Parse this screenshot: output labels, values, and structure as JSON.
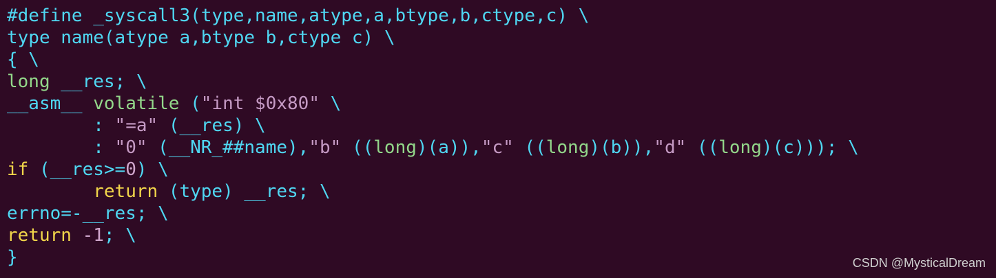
{
  "theme": {
    "background": "#2f0a24",
    "cyan": "#4fd7f2",
    "green": "#93d78a",
    "yellow": "#f1d54a",
    "string": "#c59ac4",
    "number": "#cfa6cc",
    "watermark": "#cfcfcf"
  },
  "lines": [
    {
      "tokens": [
        {
          "t": "#define _syscall3(type,name,atype,a,btype,b,ctype,c) \\",
          "c": "cyan"
        }
      ]
    },
    {
      "tokens": [
        {
          "t": "type name(atype a,btype b,ctype c) \\",
          "c": "cyan"
        }
      ]
    },
    {
      "tokens": [
        {
          "t": "{ \\",
          "c": "cyan"
        }
      ]
    },
    {
      "tokens": [
        {
          "t": "long",
          "c": "green"
        },
        {
          "t": " __res; \\",
          "c": "cyan"
        }
      ]
    },
    {
      "tokens": [
        {
          "t": "__asm__ ",
          "c": "cyan"
        },
        {
          "t": "volatile",
          "c": "green"
        },
        {
          "t": " (",
          "c": "cyan"
        },
        {
          "t": "\"int $0x80\"",
          "c": "string"
        },
        {
          "t": " \\",
          "c": "cyan"
        }
      ]
    },
    {
      "tokens": [
        {
          "t": "        : ",
          "c": "cyan"
        },
        {
          "t": "\"=a\"",
          "c": "string"
        },
        {
          "t": " (__res) \\",
          "c": "cyan"
        }
      ]
    },
    {
      "tokens": [
        {
          "t": "        : ",
          "c": "cyan"
        },
        {
          "t": "\"0\"",
          "c": "string"
        },
        {
          "t": " (__NR_##name),",
          "c": "cyan"
        },
        {
          "t": "\"b\"",
          "c": "string"
        },
        {
          "t": " ((",
          "c": "cyan"
        },
        {
          "t": "long",
          "c": "green"
        },
        {
          "t": ")(a)),",
          "c": "cyan"
        },
        {
          "t": "\"c\"",
          "c": "string"
        },
        {
          "t": " ((",
          "c": "cyan"
        },
        {
          "t": "long",
          "c": "green"
        },
        {
          "t": ")(b)),",
          "c": "cyan"
        },
        {
          "t": "\"d\"",
          "c": "string"
        },
        {
          "t": " ((",
          "c": "cyan"
        },
        {
          "t": "long",
          "c": "green"
        },
        {
          "t": ")(c))); \\",
          "c": "cyan"
        }
      ]
    },
    {
      "tokens": [
        {
          "t": "if",
          "c": "yellow"
        },
        {
          "t": " (__res>=",
          "c": "cyan"
        },
        {
          "t": "0",
          "c": "number"
        },
        {
          "t": ") \\",
          "c": "cyan"
        }
      ]
    },
    {
      "tokens": [
        {
          "t": "        ",
          "c": "cyan"
        },
        {
          "t": "return",
          "c": "yellow"
        },
        {
          "t": " (type) __res; \\",
          "c": "cyan"
        }
      ]
    },
    {
      "tokens": [
        {
          "t": "errno=-__res; \\",
          "c": "cyan"
        }
      ]
    },
    {
      "tokens": [
        {
          "t": "return",
          "c": "yellow"
        },
        {
          "t": " ",
          "c": "cyan"
        },
        {
          "t": "-1",
          "c": "number"
        },
        {
          "t": "; \\",
          "c": "cyan"
        }
      ]
    },
    {
      "tokens": [
        {
          "t": "}",
          "c": "cyan"
        }
      ]
    }
  ],
  "watermark": "CSDN @MysticalDream"
}
